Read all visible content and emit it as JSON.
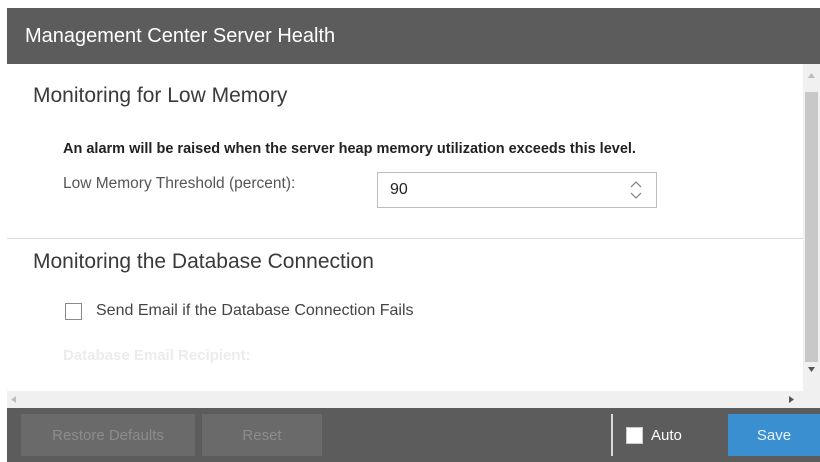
{
  "window": {
    "title": "Management Center Server Health"
  },
  "memory_section": {
    "title": "Monitoring for Low Memory",
    "alarm_note": "An alarm will be raised when the server heap memory utilization exceeds this level.",
    "threshold_label": "Low Memory Threshold (percent):",
    "threshold_value": "90"
  },
  "database_section": {
    "title": "Monitoring the Database Connection",
    "send_email_label": "Send Email if the Database Connection Fails",
    "send_email_checked": false,
    "recipient_label": "Database Email Recipient:"
  },
  "toolbar": {
    "restore_label": "Restore Defaults",
    "reset_label": "Reset",
    "auto_label": "Auto",
    "auto_checked": false,
    "save_label": "Save"
  },
  "colors": {
    "title_bar": "#5c5c5c",
    "save_button": "#3a8fd1",
    "disabled_button": "#6a6a6a"
  }
}
